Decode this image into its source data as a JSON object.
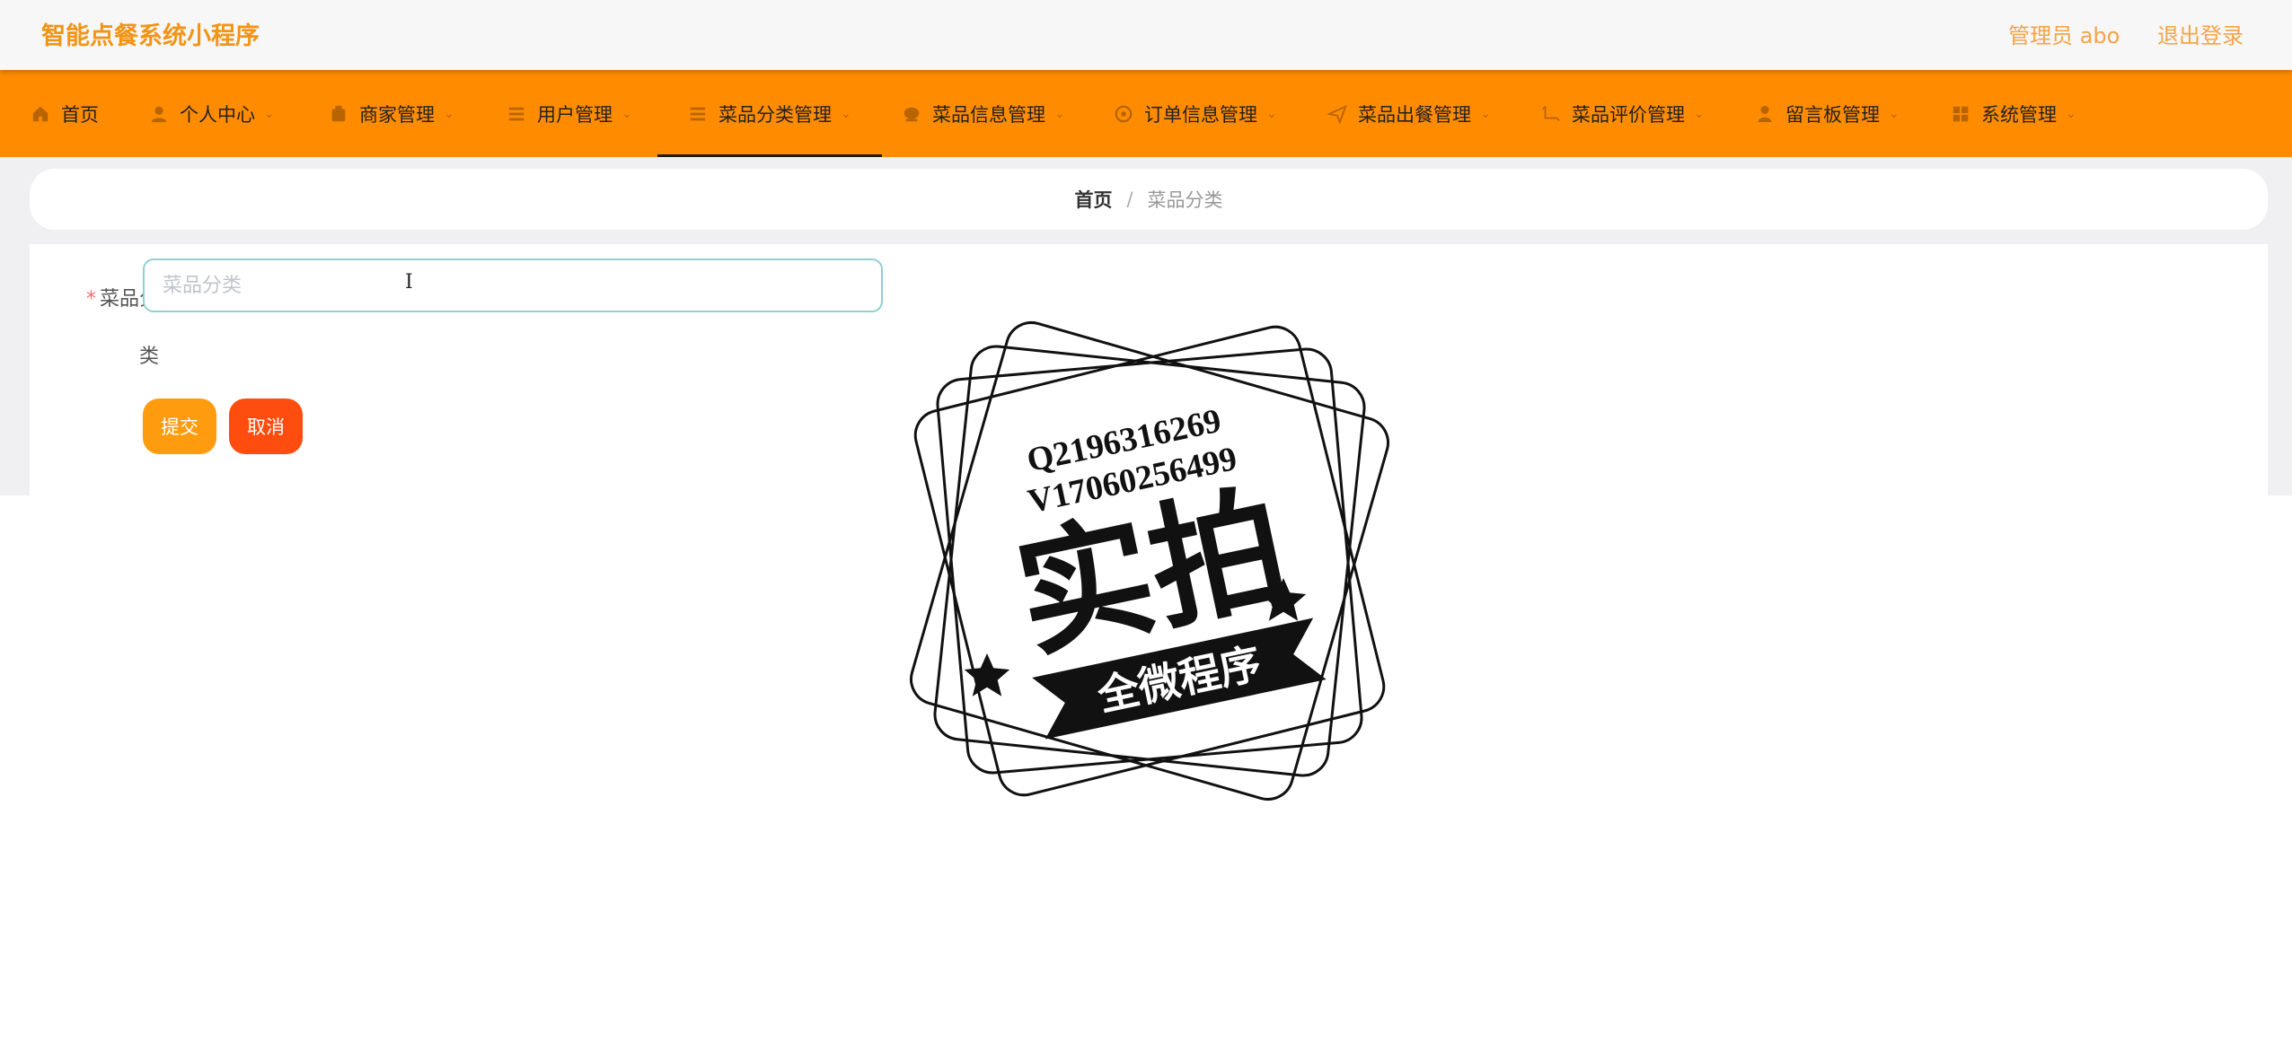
{
  "header": {
    "app_title": "智能点餐系统小程序",
    "user_label": "管理员 abo",
    "logout_label": "退出登录"
  },
  "nav": {
    "items": [
      {
        "label": "首页",
        "icon": "home-icon",
        "has_caret": false
      },
      {
        "label": "个人中心",
        "icon": "user-icon",
        "has_caret": true
      },
      {
        "label": "商家管理",
        "icon": "store-icon",
        "has_caret": true
      },
      {
        "label": "用户管理",
        "icon": "list-icon",
        "has_caret": true
      },
      {
        "label": "菜品分类管理",
        "icon": "list-icon",
        "has_caret": true,
        "active": true
      },
      {
        "label": "菜品信息管理",
        "icon": "dish-icon",
        "has_caret": true
      },
      {
        "label": "订单信息管理",
        "icon": "order-icon",
        "has_caret": true
      },
      {
        "label": "菜品出餐管理",
        "icon": "send-icon",
        "has_caret": true
      },
      {
        "label": "菜品评价管理",
        "icon": "comment-icon",
        "has_caret": true
      },
      {
        "label": "留言板管理",
        "icon": "person-icon",
        "has_caret": true
      },
      {
        "label": "系统管理",
        "icon": "grid-icon",
        "has_caret": true
      }
    ]
  },
  "breadcrumb": {
    "home": "首页",
    "separator": "/",
    "current": "菜品分类"
  },
  "form": {
    "field_label_1": "菜品分",
    "field_label_2": "类",
    "required_mark": "*",
    "input_placeholder": "菜品分类",
    "input_value": "",
    "submit_label": "提交",
    "cancel_label": "取消"
  },
  "watermark": {
    "line1": "Q2196316269",
    "line2": "V17060256499",
    "big_text": "实拍",
    "banner_text": "全微程序"
  },
  "colors": {
    "brand_orange": "#ff8c00",
    "title_orange": "#f29416",
    "submit": "#ff9b0f",
    "cancel": "#ff4d0f"
  }
}
